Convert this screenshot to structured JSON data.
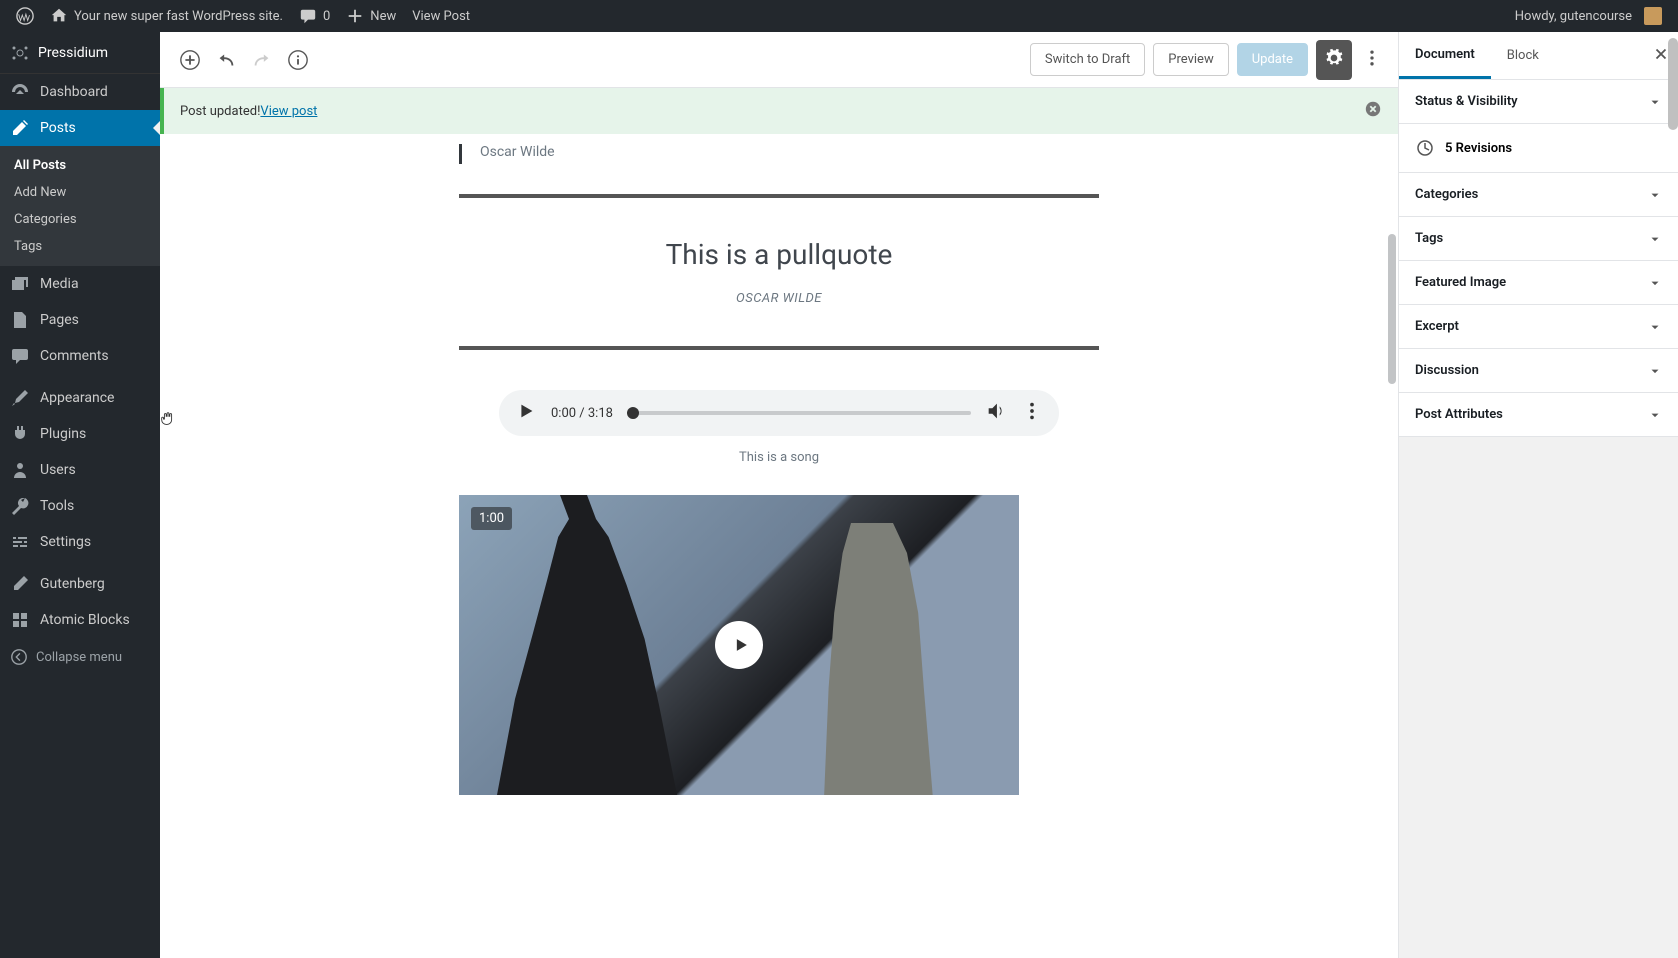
{
  "adminbar": {
    "site_name": "Your new super fast WordPress site.",
    "comments": "0",
    "new": "New",
    "view_post": "View Post",
    "howdy": "Howdy, gutencourse"
  },
  "sidebar": {
    "brand": "Pressidium",
    "items": [
      {
        "label": "Dashboard",
        "icon": "dashboard"
      },
      {
        "label": "Posts",
        "icon": "pin",
        "active": true,
        "sub": [
          {
            "label": "All Posts",
            "current": true
          },
          {
            "label": "Add New"
          },
          {
            "label": "Categories"
          },
          {
            "label": "Tags"
          }
        ]
      },
      {
        "label": "Media",
        "icon": "media"
      },
      {
        "label": "Pages",
        "icon": "pages"
      },
      {
        "label": "Comments",
        "icon": "comments"
      },
      {
        "label": "Appearance",
        "icon": "brush",
        "sep_before": true
      },
      {
        "label": "Plugins",
        "icon": "plug"
      },
      {
        "label": "Users",
        "icon": "user"
      },
      {
        "label": "Tools",
        "icon": "wrench"
      },
      {
        "label": "Settings",
        "icon": "sliders"
      },
      {
        "label": "Gutenberg",
        "icon": "pencil",
        "sep_before": true
      },
      {
        "label": "Atomic Blocks",
        "icon": "atomic"
      }
    ],
    "collapse": "Collapse menu"
  },
  "toolbar": {
    "switch_draft": "Switch to Draft",
    "preview": "Preview",
    "update": "Update"
  },
  "notice": {
    "text": "Post updated! ",
    "link": "View post"
  },
  "content": {
    "quote_cite": "Oscar Wilde",
    "pullquote_text": "This is a pullquote",
    "pullquote_cite": "OSCAR WILDE",
    "audio_time": "0:00 / 3:18",
    "audio_caption": "This is a song",
    "video_badge": "1:00"
  },
  "inspector": {
    "tabs": {
      "doc": "Document",
      "block": "Block"
    },
    "panels": [
      {
        "label": "Status & Visibility"
      },
      {
        "revisions": "5 Revisions"
      },
      {
        "label": "Categories"
      },
      {
        "label": "Tags"
      },
      {
        "label": "Featured Image"
      },
      {
        "label": "Excerpt"
      },
      {
        "label": "Discussion"
      },
      {
        "label": "Post Attributes"
      }
    ]
  }
}
